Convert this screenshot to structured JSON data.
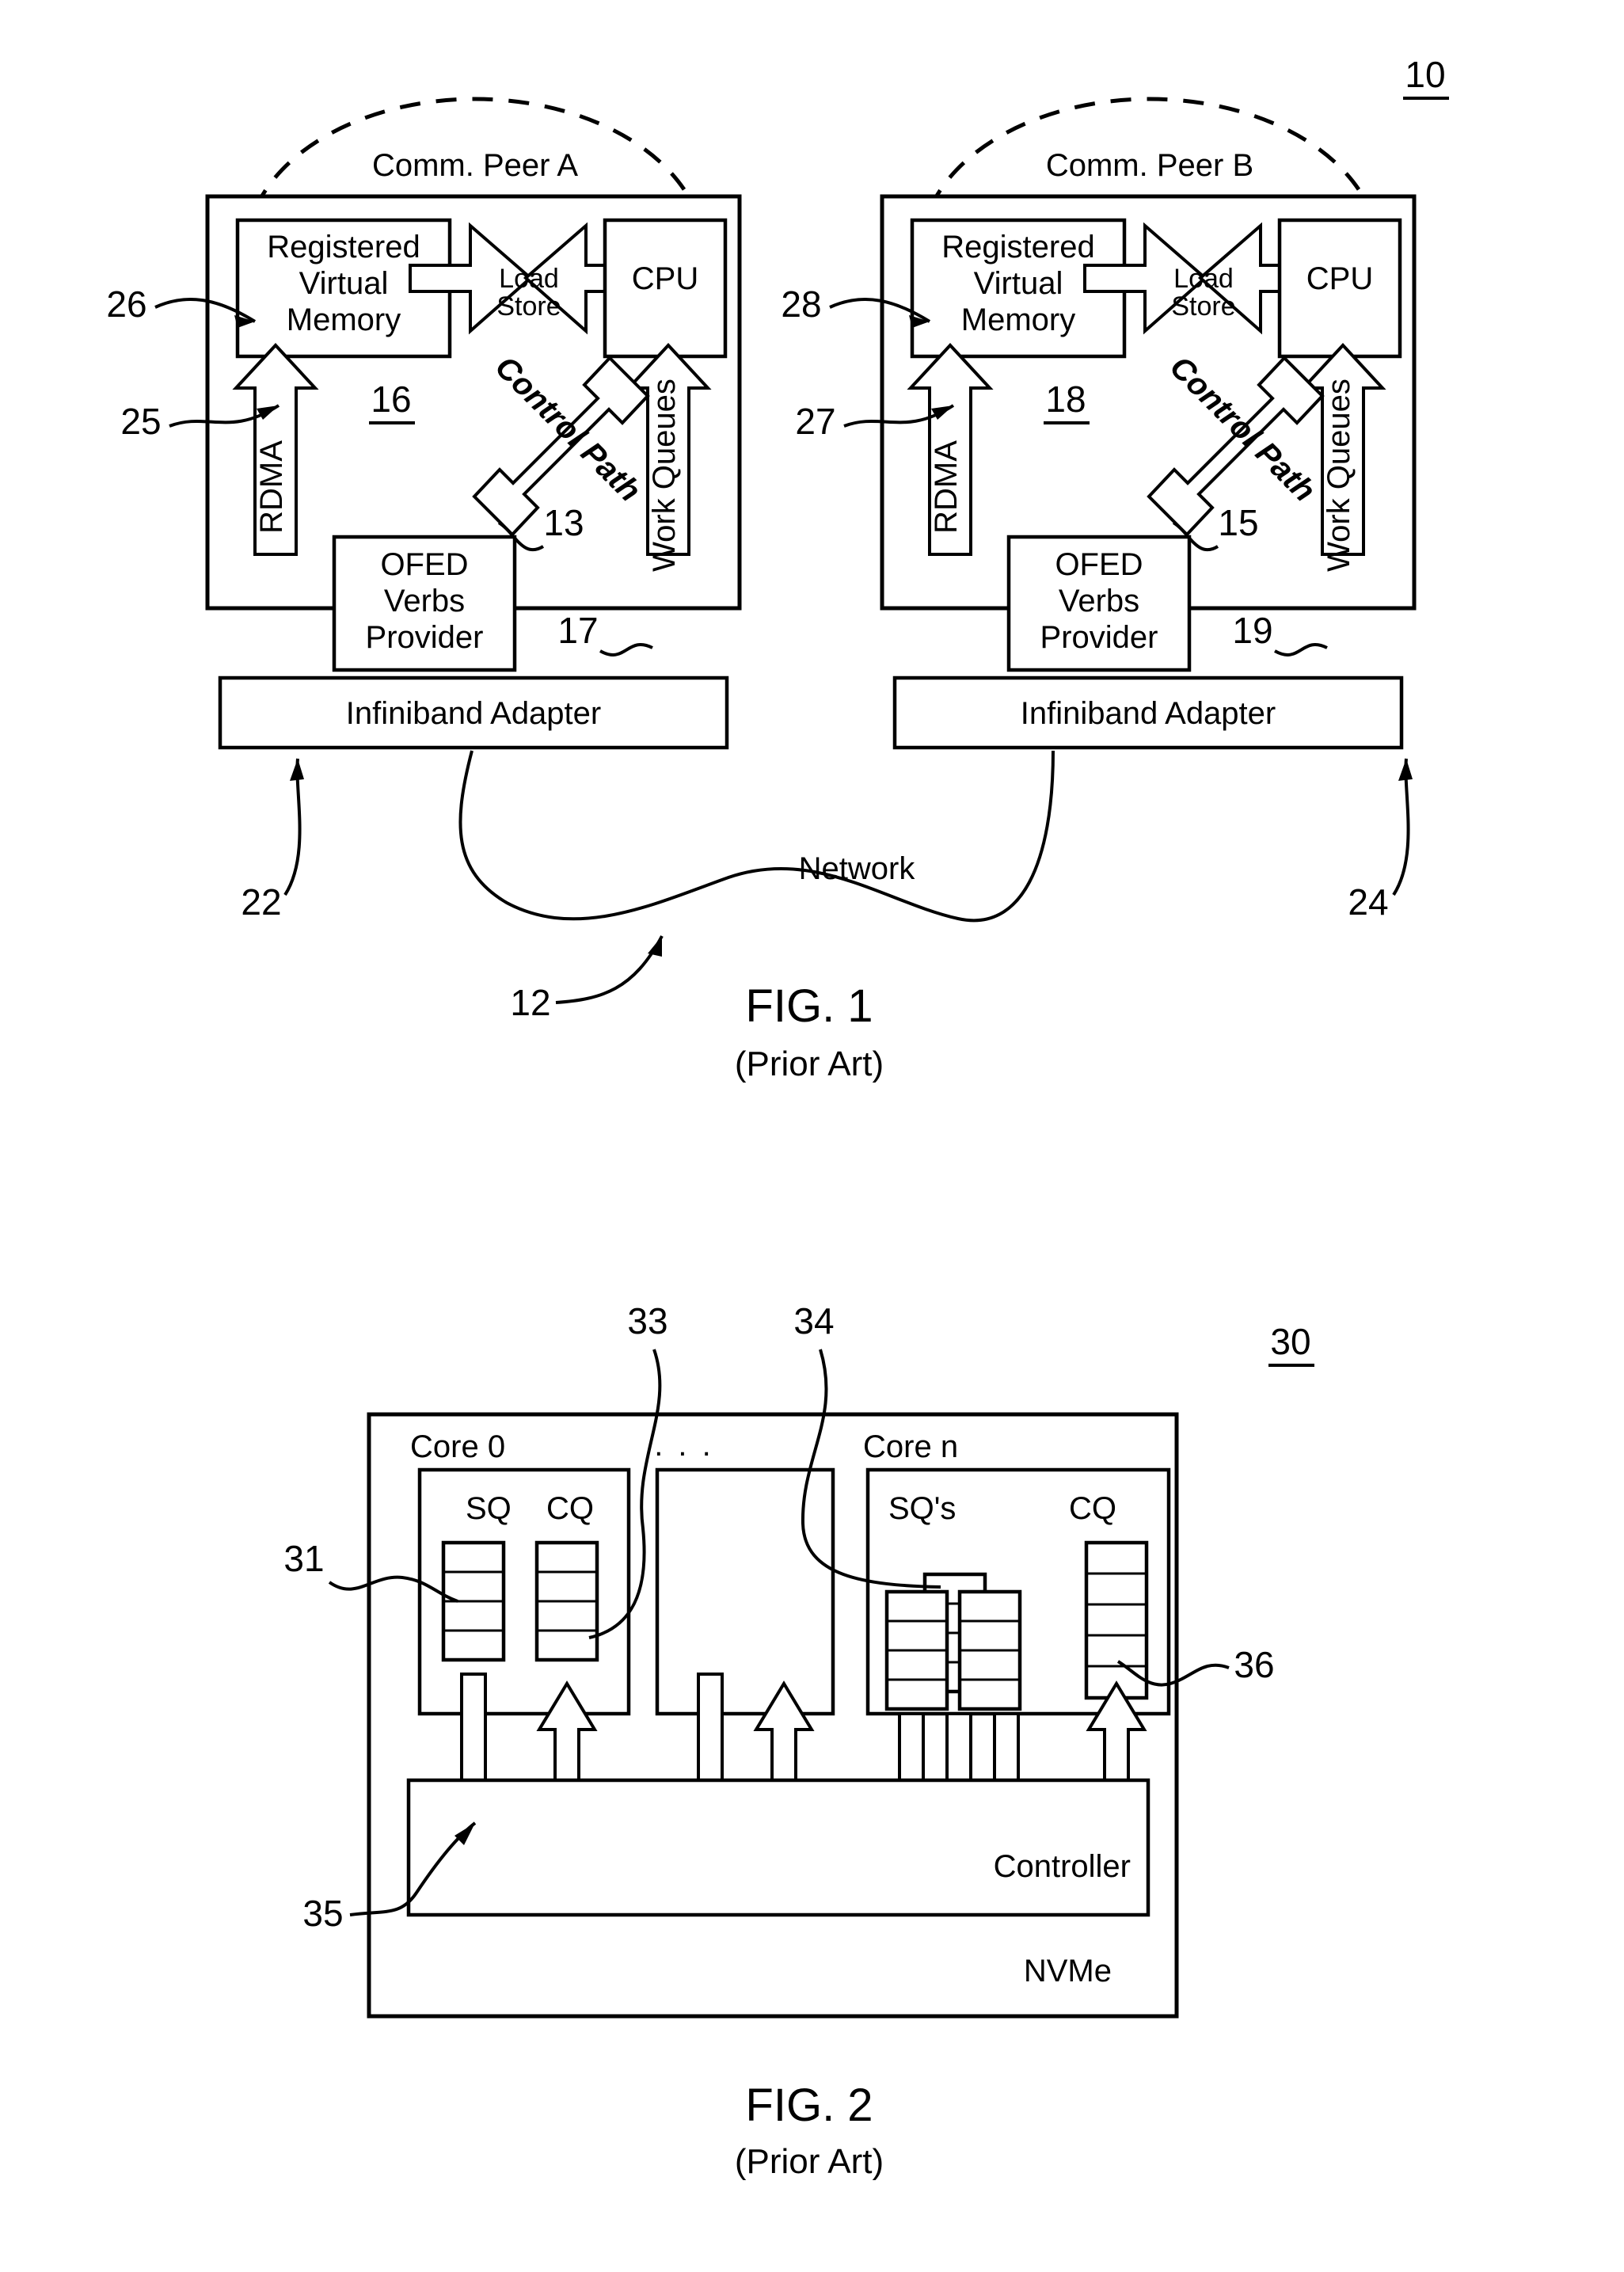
{
  "document": {
    "type": "patent-drawing-sheet",
    "figures": [
      {
        "id": "fig1",
        "caption": "FIG. 1",
        "subcaption": "(Prior Art)",
        "sheet_ref": "10",
        "network_label": "Network",
        "network_ref": "12",
        "peers": [
          {
            "name": "Comm. Peer A",
            "box_ref": "16",
            "memory_label": "Registered\nVirtual\nMemory",
            "memory_line1": "Registered",
            "memory_line2": "Virtual",
            "memory_line3": "Memory",
            "memory_ref": "26",
            "loadstore_line1": "Load",
            "loadstore_line2": "Store",
            "cpu_label": "CPU",
            "rdma_label": "RDMA",
            "rdma_ref": "25",
            "control_path_label": "Control Path",
            "control_path_ref": "13",
            "work_queues_label": "Work Queues",
            "work_queues_ref": "17",
            "ofed_line1": "OFED",
            "ofed_line2": "Verbs",
            "ofed_line3": "Provider",
            "adapter_label": "Infiniband Adapter",
            "adapter_ref": "22"
          },
          {
            "name": "Comm. Peer B",
            "box_ref": "18",
            "memory_line1": "Registered",
            "memory_line2": "Virtual",
            "memory_line3": "Memory",
            "memory_ref": "28",
            "loadstore_line1": "Load",
            "loadstore_line2": "Store",
            "cpu_label": "CPU",
            "rdma_label": "RDMA",
            "rdma_ref": "27",
            "control_path_label": "Control Path",
            "control_path_ref": "15",
            "work_queues_label": "Work Queues",
            "work_queues_ref": "19",
            "ofed_line1": "OFED",
            "ofed_line2": "Verbs",
            "ofed_line3": "Provider",
            "adapter_label": "Infiniband Adapter",
            "adapter_ref": "24"
          }
        ]
      },
      {
        "id": "fig2",
        "caption": "FIG. 2",
        "subcaption": "(Prior Art)",
        "sheet_ref": "30",
        "device_label": "NVMe",
        "controller_label": "Controller",
        "controller_ref": "35",
        "ellipsis": ". . .",
        "refs": {
          "sq_ref": "31",
          "cq_ref": "33",
          "sqs_ref": "34",
          "cq_right_ref": "36"
        },
        "cores": [
          {
            "title": "Core 0",
            "sq_label": "SQ",
            "cq_label": "CQ"
          },
          {
            "title": "",
            "sq_label": "",
            "cq_label": ""
          },
          {
            "title": "Core n",
            "sq_label": "SQ's",
            "cq_label": "CQ"
          }
        ]
      }
    ]
  },
  "colors": {
    "ink": "#000000",
    "paper": "#ffffff"
  }
}
